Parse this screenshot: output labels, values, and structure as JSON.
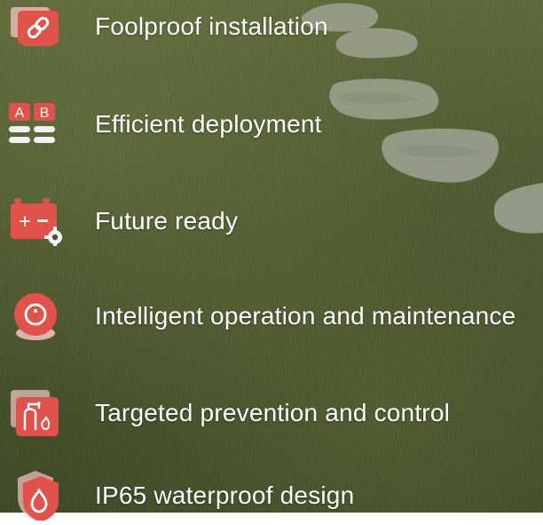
{
  "features": [
    {
      "label": "Foolproof installation",
      "icon": "link-icon"
    },
    {
      "label": "Efficient deployment",
      "icon": "ab-grid-icon"
    },
    {
      "label": "Future ready",
      "icon": "battery-gear-icon"
    },
    {
      "label": "Intelligent operation and maintenance",
      "icon": "camera-icon"
    },
    {
      "label": "Targeted prevention and control",
      "icon": "fire-hydrant-icon"
    },
    {
      "label": "IP65 waterproof design",
      "icon": "water-drop-shield-icon"
    }
  ],
  "colors": {
    "accent": "#e0524a",
    "icon_light": "#f3c7c2",
    "text": "#ffffff",
    "background_grass": "#4b5630"
  }
}
